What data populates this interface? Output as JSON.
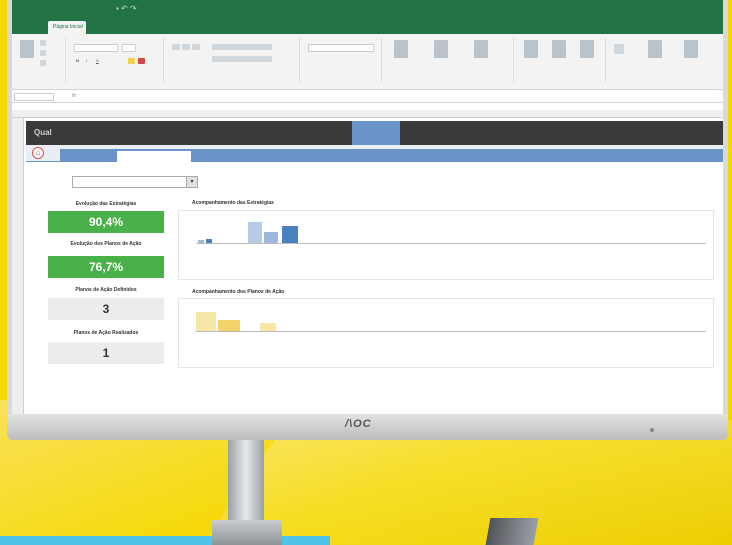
{
  "excel": {
    "active_tab": "Página Inicial",
    "title_text": "",
    "formula_cell": ""
  },
  "dashboard": {
    "nav": {
      "logo": "Qual",
      "items": [
        "",
        "",
        "",
        "",
        "",
        "",
        ""
      ],
      "active_index": 5
    },
    "subtabs": [
      ""
    ],
    "filter": {
      "label": "",
      "value": ""
    },
    "kpis": [
      {
        "title": "Evolução das Estratégias",
        "value": "90,4%",
        "style": "green"
      },
      {
        "title": "Evolução dos Planos de Ação",
        "value": "76,7%",
        "style": "green"
      },
      {
        "title": "Planos de Ação Definidos",
        "value": "3",
        "style": "gray"
      },
      {
        "title": "Planos de Ação Realizados",
        "value": "1",
        "style": "gray"
      }
    ],
    "charts": [
      {
        "title": "Acompanhamento das Estratégias"
      },
      {
        "title": "Acompanhamento dos Planos de Ação"
      }
    ]
  },
  "monitor": {
    "brand": "/\\OC"
  },
  "colors": {
    "excel_green": "#217346",
    "nav_dark": "#3a3a3a",
    "accent_blue": "#6a93c8",
    "kpi_green": "#4ab04a",
    "background_yellow": "#f5d800"
  }
}
